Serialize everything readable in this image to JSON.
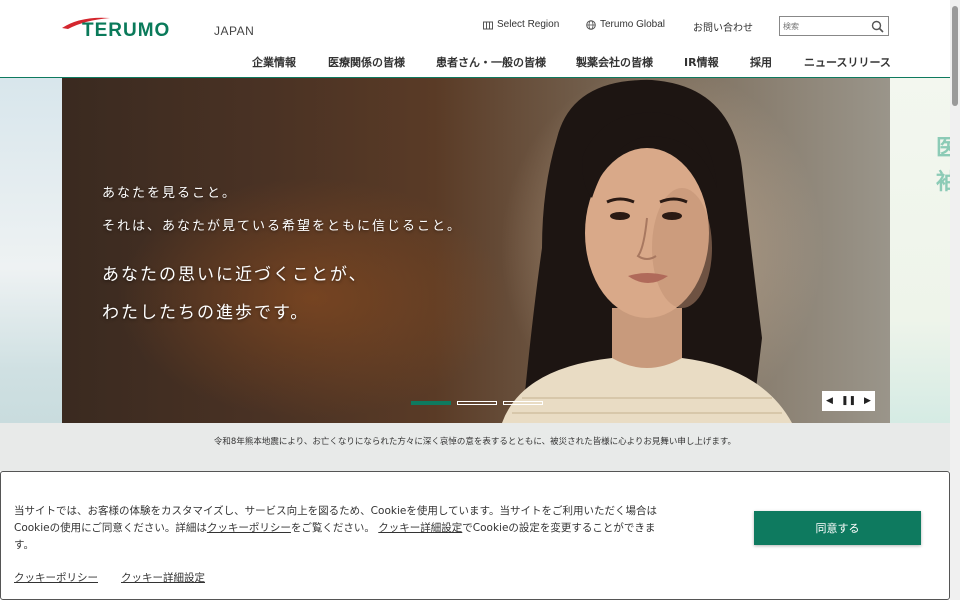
{
  "header": {
    "logo_text": "TERUMO",
    "country": "JAPAN",
    "utility": {
      "select_region": "Select Region",
      "global": "Terumo Global",
      "contact": "お問い合わせ"
    },
    "search": {
      "placeholder": "検索"
    },
    "nav": [
      "企業情報",
      "医療関係の皆様",
      "患者さん・一般の皆様",
      "製薬会社の皆様",
      "IR情報",
      "採用",
      "ニュースリリース"
    ]
  },
  "hero": {
    "lines": [
      "あなたを見ること。",
      "それは、あなたが見ている希望をともに信じること。",
      "あなたの思いに近づくことが、",
      "わたしたちの進歩です。"
    ],
    "slides_total": 3,
    "slide_active": 1,
    "controls": {
      "prev": "◀",
      "pause": "❚❚",
      "next": "▶"
    },
    "right_panel_glyphs": [
      "医",
      "袖"
    ]
  },
  "notice": {
    "text": "令和8年熊本地震により、お亡くなりになられた方々に深く哀悼の意を表するとともに、被災された皆様に心よりお見舞い申し上げます。"
  },
  "cookie": {
    "text_part1": "当サイトでは、お客様の体験をカスタマイズし、サービス向上を図るため、Cookieを使用しています。当サイトをご利用いただく場合はCookieの使用にご同意ください。詳細は",
    "link_policy_inline": "クッキーポリシー",
    "text_part2": "をご覧ください。",
    "link_settings_inline": "クッキー詳細設定",
    "text_part3": "でCookieの設定を変更することができます。",
    "accept_label": "同意する",
    "footer_link_policy": "クッキーポリシー",
    "footer_link_settings": "クッキー詳細設定"
  },
  "colors": {
    "brand_green": "#0e7a5f",
    "logo_red": "#d4262e"
  }
}
